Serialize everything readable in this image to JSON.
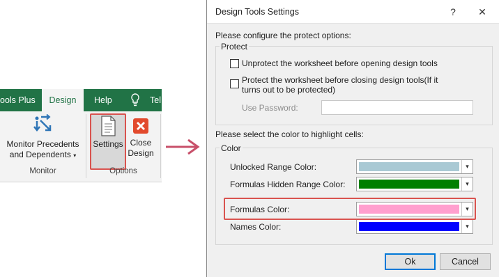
{
  "ribbon": {
    "tabs": [
      "ools Plus",
      "Design",
      "Help",
      "Tel"
    ],
    "monitor_button": [
      "Monitor Precedents",
      "and Dependents"
    ],
    "monitor_group": "Monitor",
    "settings_button": "Settings",
    "close_button": [
      "Close",
      "Design"
    ],
    "options_group": "Options"
  },
  "dialog": {
    "title": "Design Tools Settings",
    "help_glyph": "?",
    "close_glyph": "✕",
    "protect_intro": "Please configure the protect options:",
    "protect_group": "Protect",
    "unprotect_label": "Unprotect the worksheet before opening design tools",
    "protect_label": [
      "Protect the worksheet before closing design tools(If it",
      "turns out to be protected)"
    ],
    "password_label": "Use Password:",
    "password_value": "",
    "color_intro": "Please select the color to highlight cells:",
    "color_group": "Color",
    "colors": [
      {
        "label": "Unlocked Range Color:",
        "color": "#a9c9d4"
      },
      {
        "label": "Formulas Hidden Range Color:",
        "color": "#008000"
      },
      {
        "label": "Formulas Color:",
        "color": "#ff9fce"
      },
      {
        "label": "Names Color:",
        "color": "#0000ff"
      }
    ],
    "ok_label": "Ok",
    "cancel_label": "Cancel"
  },
  "icons": {
    "help": "question-mark-icon",
    "close": "close-icon",
    "dropdown": "chevron-down-icon",
    "tell_me": "lightbulb-icon",
    "monitor": "trace-arrows-icon",
    "settings": "document-icon",
    "close_design": "red-x-icon",
    "arrow": "arrow-right-icon"
  },
  "accent": {
    "ribbon_green": "#217346",
    "highlight_red": "#d9534f",
    "focus_blue": "#0078d7"
  }
}
